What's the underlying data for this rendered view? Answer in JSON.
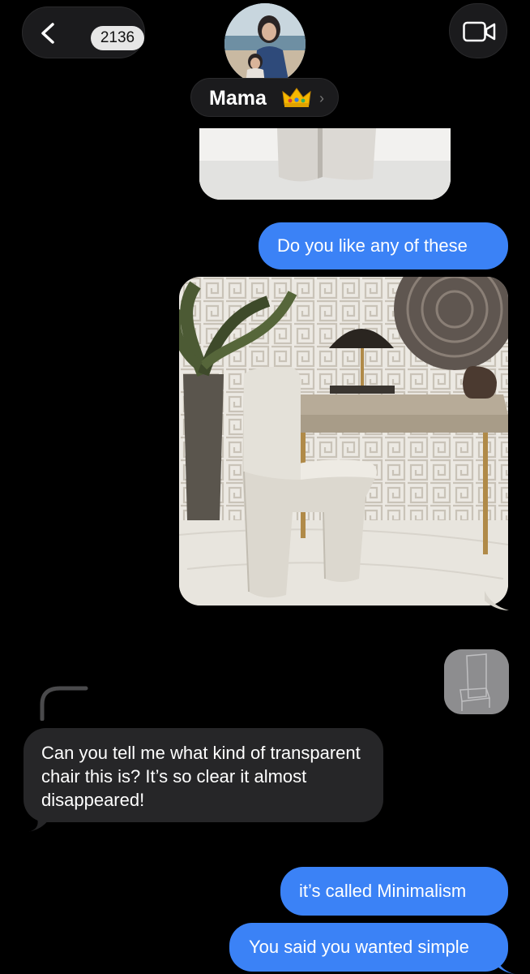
{
  "header": {
    "back_count": "2136",
    "contact_name": "Mama",
    "name_emoji": "crown-icon"
  },
  "messages": [
    {
      "id": 1,
      "direction": "outgoing",
      "type": "image",
      "description": "chair legs partial photo"
    },
    {
      "id": 2,
      "direction": "outgoing",
      "type": "text",
      "text": "Do you like any of these"
    },
    {
      "id": 3,
      "direction": "outgoing",
      "type": "image",
      "description": "white upholstered chair by desk"
    },
    {
      "id": 4,
      "direction": "incoming",
      "type": "text",
      "text": "Can you tell me what kind of transparent chair this is? It’s so clear it almost disappeared!"
    },
    {
      "id": 5,
      "direction": "outgoing",
      "type": "text",
      "text": "it’s called Minimalism"
    },
    {
      "id": 6,
      "direction": "outgoing",
      "type": "text",
      "text": "You said you wanted simple"
    }
  ],
  "colors": {
    "background": "#000000",
    "outgoing_bubble": "#3b82f6",
    "incoming_bubble": "#262628",
    "header_pill": "#1b1b1d"
  }
}
